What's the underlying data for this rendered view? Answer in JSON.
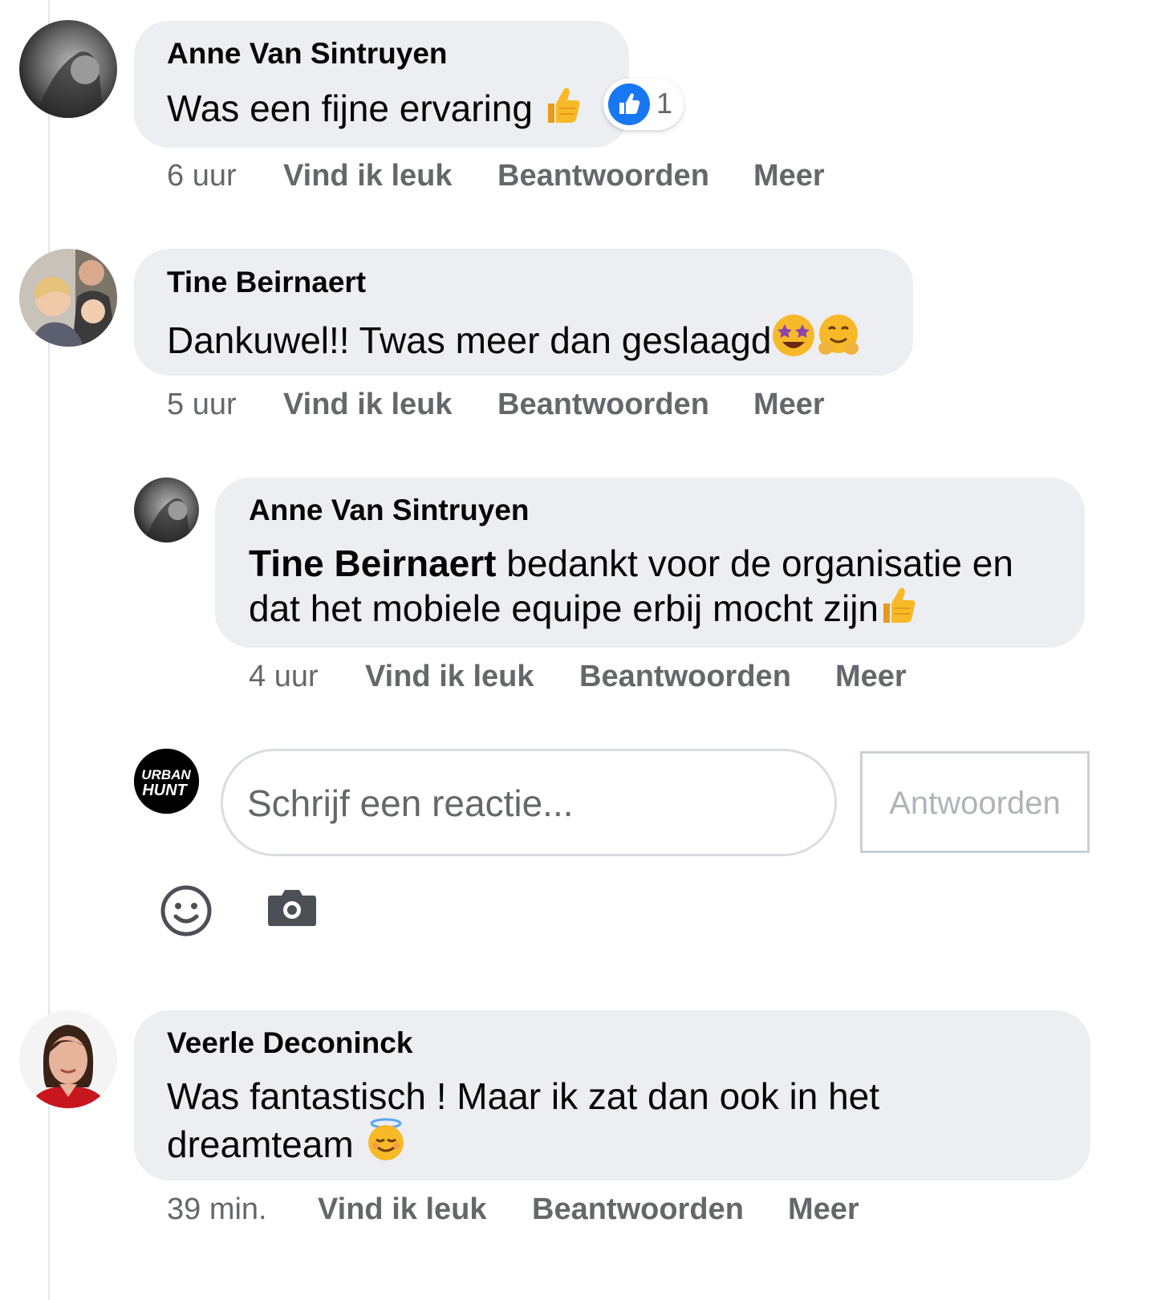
{
  "comments": [
    {
      "author": "Anne Van Sintruyen",
      "text": "Was een fijne ervaring",
      "emoji": "thumbs-up-emoji",
      "reaction_count": "1",
      "time": "6 uur",
      "like": "Vind ik leuk",
      "reply": "Beantwoorden",
      "more": "Meer"
    },
    {
      "author": "Tine Beirnaert",
      "text": "Dankuwel!! Twas meer dan geslaagd",
      "emoji": [
        "star-struck-emoji",
        "hugging-face-emoji"
      ],
      "time": "5 uur",
      "like": "Vind ik leuk",
      "reply": "Beantwoorden",
      "more": "Meer"
    },
    {
      "author": "Anne Van Sintruyen",
      "mention": "Tine Beirnaert",
      "text_line1": "bedankt voor de organisatie en",
      "text_line2": "dat het mobiele equipe erbij mocht zijn",
      "emoji": "thumbs-up-emoji",
      "time": "4 uur",
      "like": "Vind ik leuk",
      "reply": "Beantwoorden",
      "more": "Meer"
    },
    {
      "author": "Veerle Deconinck",
      "text_line1": "Was fantastisch ! Maar ik zat dan ook in het",
      "text_line2": "dreamteam",
      "emoji": "smiling-face-with-halo-emoji",
      "time": "39 min.",
      "like": "Vind ik leuk",
      "reply": "Beantwoorden",
      "more": "Meer"
    }
  ],
  "composer": {
    "avatar_line1": "URBAN",
    "avatar_line2": "HUNT",
    "placeholder": "Schrijf een reactie...",
    "submit_label": "Antwoorden",
    "tools": [
      "smiley-icon",
      "camera-icon"
    ]
  },
  "colors": {
    "bubble": "#eceef1",
    "meta_text": "#65676b",
    "like_blue": "#1877f2"
  }
}
